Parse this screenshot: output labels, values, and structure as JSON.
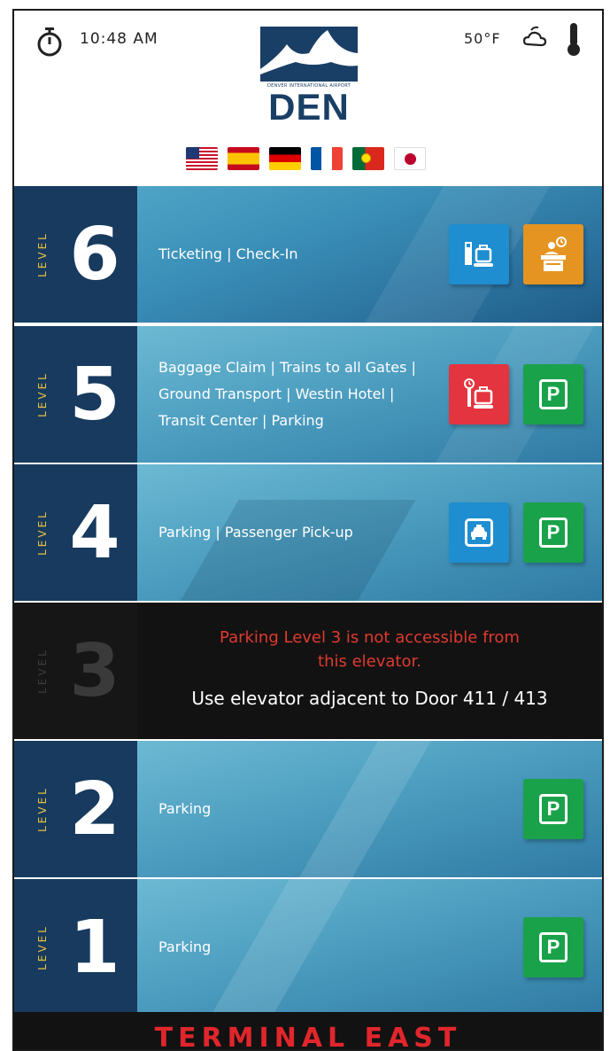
{
  "header": {
    "time": "10:48 AM",
    "temperature": "50°F",
    "logo_caption": "DENVER INTERNATIONAL AIRPORT",
    "logo_text": "DEN",
    "flags": [
      "us",
      "es",
      "de",
      "fr",
      "pt",
      "jp"
    ]
  },
  "levels": [
    {
      "word": "LEVEL",
      "number": "6",
      "description": "Ticketing | Check-In",
      "icons": [
        "baggage-conveyor-icon",
        "check-in-desk-icon"
      ]
    },
    {
      "word": "LEVEL",
      "number": "5",
      "description": "Baggage Claim | Trains to all Gates | Ground Transport | Westin Hotel | Transit Center | Parking",
      "icons": [
        "baggage-claim-icon",
        "parking-icon"
      ]
    },
    {
      "word": "LEVEL",
      "number": "4",
      "description": "Parking | Passenger Pick-up",
      "icons": [
        "taxi-icon",
        "parking-icon"
      ]
    },
    {
      "word": "LEVEL",
      "number": "3",
      "warning": "Parking Level 3 is not accessible from this elevator.",
      "note": "Use elevator adjacent to Door 411 / 413"
    },
    {
      "word": "LEVEL",
      "number": "2",
      "description": "Parking",
      "icons": [
        "parking-icon"
      ]
    },
    {
      "word": "LEVEL",
      "number": "1",
      "description": "Parking",
      "icons": [
        "parking-icon"
      ]
    }
  ],
  "parking_letter": "P",
  "footer": {
    "terminal": "TERMINAL EAST"
  },
  "colors": {
    "navy": "#173a5e",
    "level_text": "#e6c042",
    "warning": "#e03a2f",
    "terminal": "#e0262c",
    "tile_blue": "#1e8ed0",
    "tile_orange": "#e59421",
    "tile_red": "#e4343f",
    "tile_green": "#1aa24a"
  }
}
